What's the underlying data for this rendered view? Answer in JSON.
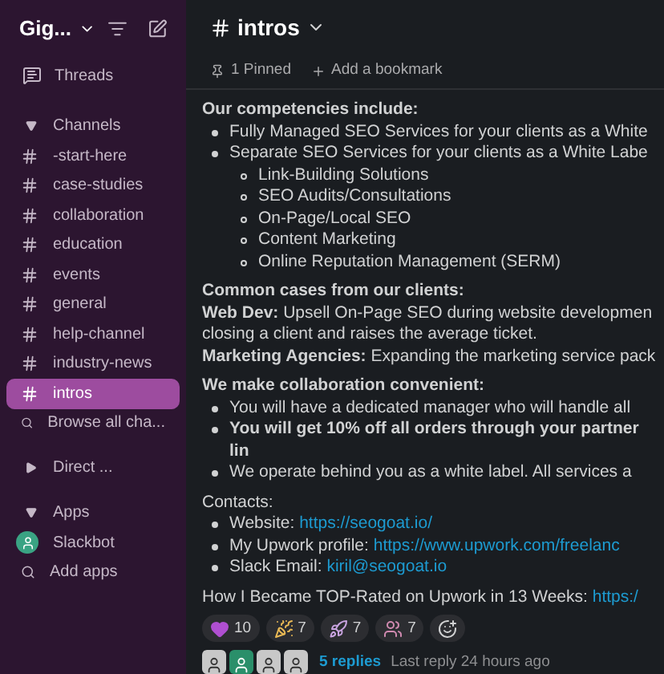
{
  "workspace": {
    "name": "Gig..."
  },
  "sidebar": {
    "threads": "Threads",
    "sections": [
      {
        "kind": "channels",
        "label": "Channels",
        "expanded": true,
        "items": [
          {
            "label": "-start-here",
            "selected": false
          },
          {
            "label": "case-studies",
            "selected": false
          },
          {
            "label": "collaboration",
            "selected": false
          },
          {
            "label": "education",
            "selected": false
          },
          {
            "label": "events",
            "selected": false
          },
          {
            "label": "general",
            "selected": false
          },
          {
            "label": "help-channel",
            "selected": false
          },
          {
            "label": "industry-news",
            "selected": false
          },
          {
            "label": "intros",
            "selected": true
          }
        ],
        "browse": "Browse all cha..."
      },
      {
        "kind": "direct",
        "label": "Direct ...",
        "expanded": false
      },
      {
        "kind": "apps",
        "label": "Apps",
        "expanded": true,
        "items": [
          {
            "label": "Slackbot",
            "selected": false
          }
        ],
        "browse": "Add apps"
      }
    ]
  },
  "channel": {
    "title": "intros",
    "pinned": "1 Pinned",
    "bookmark": "Add a bookmark"
  },
  "message": {
    "blocks": [
      {
        "kind": "heading",
        "text": "Our competencies include:"
      },
      {
        "kind": "bullet",
        "text": "Fully Managed SEO Services for your clients as a White"
      },
      {
        "kind": "bullet",
        "text": "Separate SEO Services for your clients as a White Labe",
        "children": [
          {
            "text": "Link-Building Solutions"
          },
          {
            "text": "SEO Audits/Consultations"
          },
          {
            "text": "On-Page/Local SEO"
          },
          {
            "text": "Content Marketing"
          },
          {
            "text": "Online Reputation Management (SERM)"
          }
        ]
      },
      {
        "kind": "heading",
        "text": "Common cases from our clients:"
      },
      {
        "kind": "para",
        "text": "**Web Dev:** Upsell On-Page SEO during website developmen"
      },
      {
        "kind": "para",
        "text": "closing a client and raises the average ticket."
      },
      {
        "kind": "para",
        "text": "**Marketing Agencies:** Expanding the marketing service pack"
      },
      {
        "kind": "heading",
        "text": "We make collaboration convenient:"
      },
      {
        "kind": "bullet",
        "text": "You will have a dedicated manager who will handle all"
      },
      {
        "kind": "bullet",
        "text": "**You will get 10% off all orders through your partner lin**"
      },
      {
        "kind": "bullet",
        "text": "We operate behind you as a white label. All services a"
      },
      {
        "kind": "heading_plain",
        "text": "Contacts:"
      },
      {
        "kind": "link_bullet",
        "text": "Website:",
        "link": "https://seogoat.io/"
      },
      {
        "kind": "link_bullet",
        "text": "My Upwork profile:",
        "link": "https://www.upwork.com/freelanc"
      },
      {
        "kind": "link_bullet",
        "text": "Slack Email:",
        "link": "kiril@seogoat.io"
      },
      {
        "kind": "link_para",
        "text": "How I Became TOP-Rated on Upwork in 13 Weeks:",
        "link": "https:/"
      }
    ],
    "reactions": [
      {
        "kind": "heart",
        "count": "10"
      },
      {
        "kind": "party",
        "count": "7"
      },
      {
        "kind": "rocket",
        "count": "7"
      },
      {
        "kind": "people",
        "count": "7"
      }
    ],
    "thread": {
      "replies": "5 replies",
      "last": "Last reply 24 hours ago"
    }
  }
}
